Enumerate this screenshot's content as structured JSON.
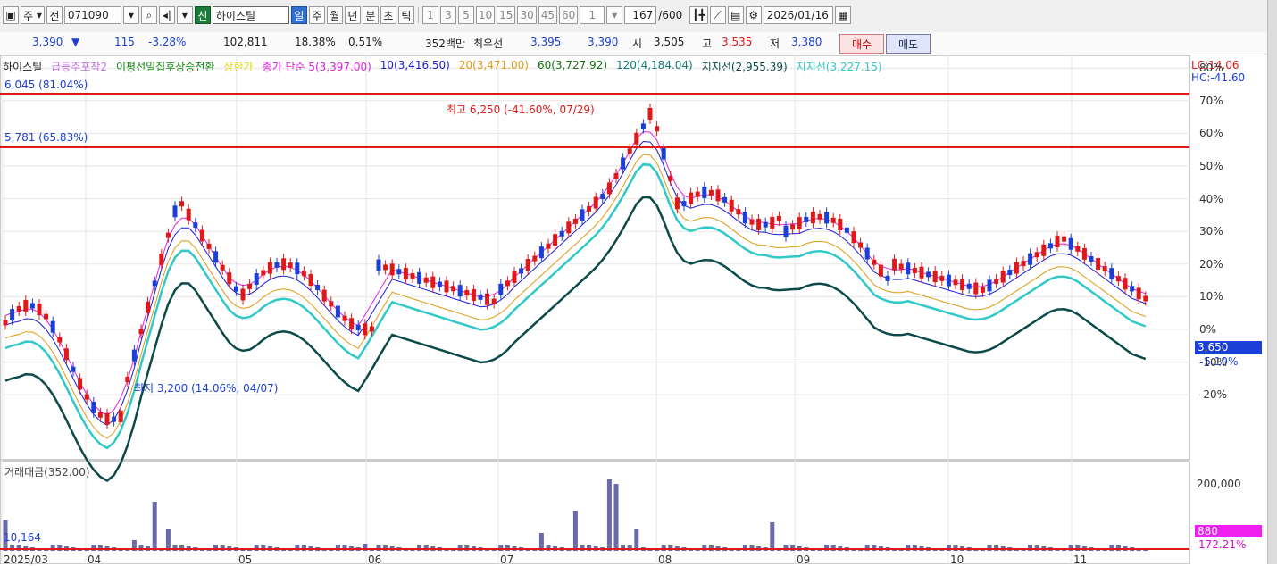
{
  "toolbar": {
    "mode_label": "주",
    "period_label": "전",
    "code_value": "071090",
    "new_label": "신",
    "stock_name": "하이스틸",
    "periods": [
      "일",
      "주",
      "월",
      "년",
      "분",
      "초",
      "틱"
    ],
    "active_period": "일",
    "intervals": [
      "1",
      "3",
      "5",
      "10",
      "15",
      "30",
      "45",
      "60"
    ],
    "interval_value": "1",
    "count_value": "167",
    "count_total": "/600",
    "date_value": "2026/01/16"
  },
  "quote": {
    "price": "3,390",
    "change": "115",
    "change_pct": "-3.28%",
    "volume": "102,811",
    "turnover_rate": "18.38%",
    "ratio": "0.51%",
    "amount": "352백만",
    "best_ask_label": "최우선",
    "best_ask": "3,395",
    "best_bid": "3,390",
    "open_label": "시",
    "open": "3,505",
    "high_label": "고",
    "high": "3,535",
    "low_label": "저",
    "low": "3,380",
    "buy_label": "매수",
    "sell_label": "매도"
  },
  "legend": [
    {
      "text": "하이스틸",
      "color": "#222222"
    },
    {
      "text": "급등주포착2",
      "color": "#c070e0"
    },
    {
      "text": "이평선밀집후상승전환",
      "color": "#118811"
    },
    {
      "text": "상한가",
      "color": "#e8d800"
    },
    {
      "text": "종가 단순 5(3,397.00)",
      "color": "#e020e0"
    },
    {
      "text": "10(3,416.50)",
      "color": "#1b1bd8"
    },
    {
      "text": "20(3,471.00)",
      "color": "#e09a10"
    },
    {
      "text": "60(3,727.92)",
      "color": "#117711"
    },
    {
      "text": "120(4,184.04)",
      "color": "#117777"
    },
    {
      "text": "지지선(2,955.39)",
      "color": "#0c4a4a"
    },
    {
      "text": "지지선(3,227.15)",
      "color": "#30c8c8"
    }
  ],
  "annotations": {
    "lc": "LC:14.06",
    "hc": "HC:-41.60",
    "top_left_a": "6,045 (81.04%)",
    "top_left_b": "5,781 (65.83%)",
    "high_note": "최고 6,250 (-41.60%, 07/29)",
    "low_note": "최저 3,200 (14.06%, 04/07)",
    "current_price_tag": "3,650",
    "current_pct_tag": "-5.19%"
  },
  "y_axis_labels": [
    "80%",
    "70%",
    "60%",
    "50%",
    "40%",
    "30%",
    "20%",
    "10%",
    "0%",
    "-10%",
    "-20%"
  ],
  "x_axis_labels": [
    "2025/03",
    "04",
    "05",
    "06",
    "07",
    "08",
    "09",
    "10",
    "11"
  ],
  "volume_panel": {
    "title": "거래대금(352.00)",
    "left_value": "10,164",
    "axis_label": "200,000",
    "tag_value": "880",
    "tag_pct": "172.21%"
  },
  "colors": {
    "up": "#e01818",
    "down": "#1b3fd8",
    "resistance": "#e01818",
    "volume_bar": "#6a6aa8"
  },
  "chart_data": {
    "type": "candlestick",
    "x": [
      "2025/03",
      "04",
      "05",
      "06",
      "07",
      "08",
      "09",
      "10",
      "11"
    ],
    "ylim_pct": [
      -25,
      82
    ],
    "horizontal_lines_pct": [
      80,
      65
    ],
    "series": [
      {
        "name": "5",
        "values": []
      },
      {
        "name": "10",
        "values": []
      },
      {
        "name": "20",
        "values": []
      },
      {
        "name": "60",
        "values": []
      },
      {
        "name": "120",
        "values": []
      }
    ]
  }
}
